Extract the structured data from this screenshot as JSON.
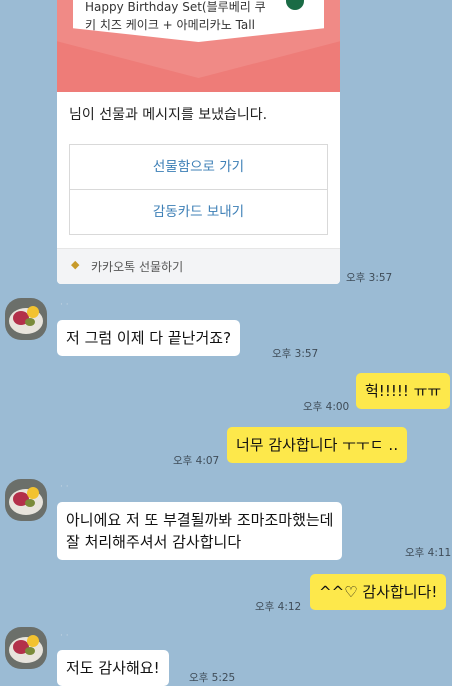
{
  "gift_card": {
    "product_line1": "Happy Birthday Set(블루베리 쿠",
    "product_line2": "키 치즈 케이크 + 아메리카노 Tall",
    "message": "님이 선물과 메시지를 보냈습니다.",
    "button_gift_box": "선물함으로 가기",
    "button_thanks_card": "감동카드 보내기",
    "footer_label": "카카오톡 선물하기",
    "footer_icon": "gift-icon",
    "timestamp": "오후 3:57"
  },
  "messages": [
    {
      "side": "in",
      "text": "저 그럼 이제 다 끝난거죠?",
      "time": "오후 3:57"
    },
    {
      "side": "out",
      "text": "헉!!!!! ㅠㅠ",
      "time": "오후 4:00"
    },
    {
      "side": "out",
      "text": "너무 감사합니다 ㅜㅜㄷ ‥",
      "time": "오후 4:07"
    },
    {
      "side": "in",
      "line1": "아니에요 저 또 부결될까봐 조마조마했는데",
      "line2": "잘 처리해주셔서 감사합니다",
      "time": "오후 4:11"
    },
    {
      "side": "out",
      "text": "^^♡ 감사합니다!",
      "time": "오후 4:12"
    },
    {
      "side": "in",
      "text": "저도 감사해요!",
      "time": "오후 5:25"
    }
  ],
  "colors": {
    "background": "#9bbbd4",
    "my_bubble": "#fde84b",
    "their_bubble": "#ffffff",
    "gift_banner": "#f08a86",
    "link_blue": "#3d7fb6"
  }
}
